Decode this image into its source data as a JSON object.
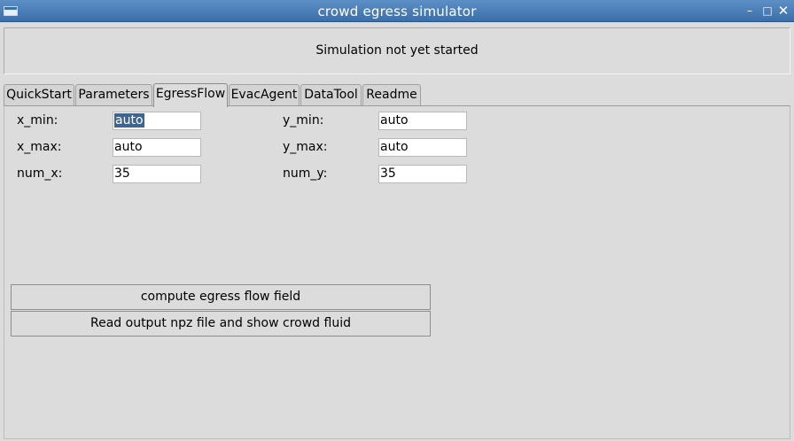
{
  "window": {
    "title": "crowd egress simulator",
    "minimize_glyph": "–",
    "maximize_glyph": "□",
    "close_glyph": "✕"
  },
  "status": {
    "text": "Simulation not yet started"
  },
  "tabs": [
    {
      "label": "QuickStart"
    },
    {
      "label": "Parameters"
    },
    {
      "label": "EgressFlow"
    },
    {
      "label": "EvacAgent"
    },
    {
      "label": "DataTool"
    },
    {
      "label": "Readme"
    }
  ],
  "active_tab": "EgressFlow",
  "fields": {
    "x_min": {
      "label": "x_min:",
      "value": "auto"
    },
    "x_max": {
      "label": "x_max:",
      "value": "auto"
    },
    "num_x": {
      "label": "num_x:",
      "value": "35"
    },
    "y_min": {
      "label": "y_min:",
      "value": "auto"
    },
    "y_max": {
      "label": "y_max:",
      "value": "auto"
    },
    "num_y": {
      "label": "num_y:",
      "value": "35"
    }
  },
  "buttons": {
    "compute": "compute egress flow field",
    "read_output": "Read output npz file and show crowd fluid"
  }
}
